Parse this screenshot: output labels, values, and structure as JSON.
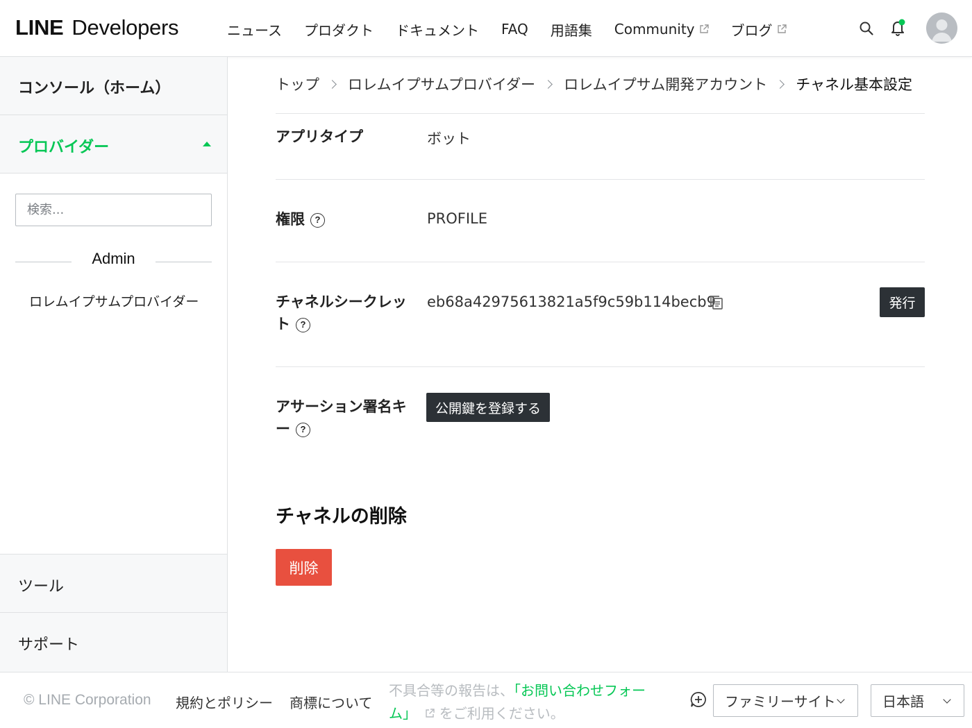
{
  "header": {
    "logo_line": "LINE",
    "logo_dev": "Developers",
    "nav": [
      {
        "label": "ニュース",
        "external": false
      },
      {
        "label": "プロダクト",
        "external": false
      },
      {
        "label": "ドキュメント",
        "external": false
      },
      {
        "label": "FAQ",
        "external": false
      },
      {
        "label": "用語集",
        "external": false
      },
      {
        "label": "Community",
        "external": true
      },
      {
        "label": "ブログ",
        "external": true
      }
    ],
    "notification_dot_color": "#06c755"
  },
  "sidebar": {
    "console_home": "コンソール（ホーム）",
    "providers_title": "プロバイダー",
    "search_placeholder": "検索...",
    "group_label": "Admin",
    "provider_item": "ロレムイプサムプロバイダー",
    "tools": "ツール",
    "support": "サポート"
  },
  "breadcrumb": [
    "トップ",
    "ロレムイプサムプロバイダー",
    "ロレムイプサム開発アカウント",
    "チャネル基本設定"
  ],
  "fields": {
    "app_type_label": "アプリタイプ",
    "app_type_value": "ボット",
    "permissions_label": "権限",
    "permissions_value": "PROFILE",
    "secret_label_1": "チャネルシークレッ",
    "secret_label_2": "ト",
    "secret_value": "eb68a42975613821a5f9c59b114becb9",
    "issue_button": "発行",
    "assertion_label_1": "アサーション署名キ",
    "assertion_label_2": "ー",
    "register_key_button": "公開鍵を登録する"
  },
  "delete_section": {
    "title": "チャネルの削除",
    "button": "削除"
  },
  "footer": {
    "copyright": "© LINE Corporation",
    "terms": "規約とポリシー",
    "trademark": "商標について",
    "report_prefix": "不具合等の報告は、",
    "report_link_1": "「お問い合わせフォー",
    "report_link_2": "ム」",
    "report_suffix": "をご利用ください。",
    "family_site": "ファミリーサイト",
    "language": "日本語"
  },
  "colors": {
    "brand_green": "#06c755",
    "danger": "#e8503f",
    "dark_button": "#2c3136"
  }
}
